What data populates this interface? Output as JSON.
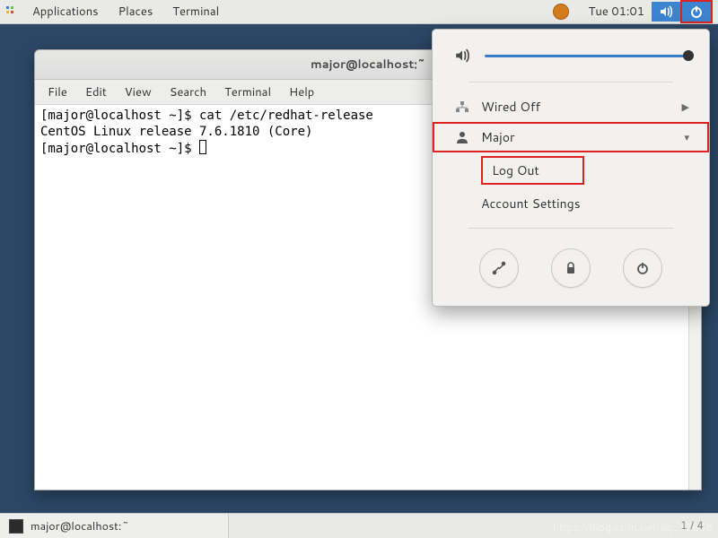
{
  "topbar": {
    "applications": "Applications",
    "places": "Places",
    "terminal": "Terminal",
    "clock": "Tue 01:01"
  },
  "terminal": {
    "title": "major@localhost:~",
    "menus": {
      "file": "File",
      "edit": "Edit",
      "view": "View",
      "search": "Search",
      "terminal": "Terminal",
      "help": "Help"
    },
    "lines": {
      "l1": "[major@localhost ~]$ cat /etc/redhat-release",
      "l2": "CentOS Linux release 7.6.1810 (Core)",
      "l3": "[major@localhost ~]$ "
    }
  },
  "dropdown": {
    "wired": "Wired Off",
    "user": "Major",
    "logout": "Log Out",
    "account": "Account Settings"
  },
  "taskbar": {
    "task1": "major@localhost:~"
  },
  "footer": {
    "watermark": "https://blog.csdn.net/qq_32838",
    "page": "1 / 4"
  }
}
